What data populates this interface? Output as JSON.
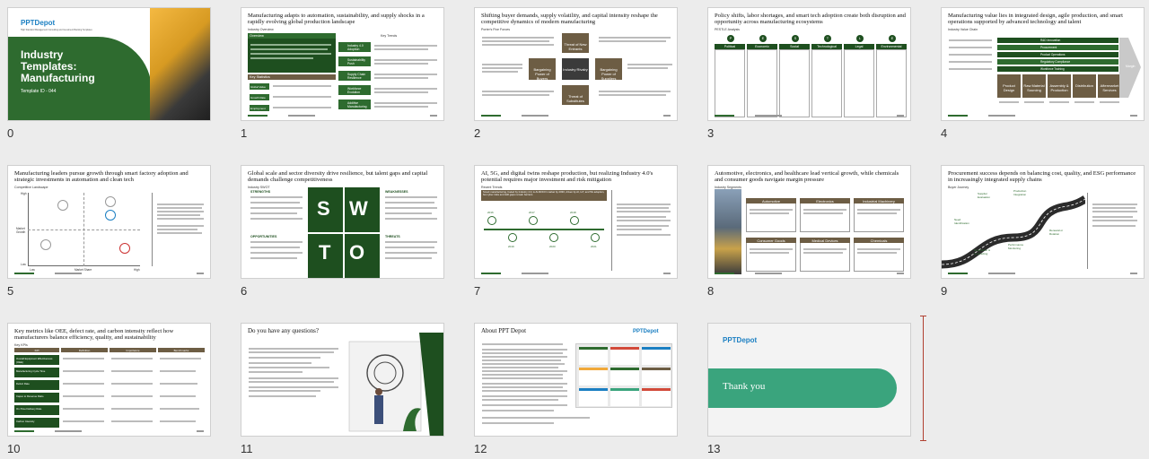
{
  "slides": [
    {
      "num": "0",
      "brand": "PPTDepot",
      "tagline": "High Standard Management Consulting and Investment Banking Templates",
      "title_line1": "Industry",
      "title_line2": "Templates:",
      "title_line3": "Manufacturing",
      "template_id": "Template ID - 044"
    },
    {
      "num": "1",
      "title": "Manufacturing adapts to automation, sustainability, and supply shocks in a rapidly evolving global production landscape",
      "sub": "Industry Overview",
      "box1": "Overview",
      "box2": "Key Statistics",
      "trends_header": "Key Trends",
      "trends": [
        "Industry 4.0 Adoption",
        "Sustainability Push",
        "Supply Chain Resilience",
        "Workforce Evolution",
        "Additive Manufacturing"
      ],
      "stats": [
        "Global Value",
        "Growth Rate",
        "Employment"
      ]
    },
    {
      "num": "2",
      "title": "Shifting buyer demands, supply volatility, and capital intensity reshape the competitive dynamics of modern manufacturing",
      "sub": "Porter's Five Forces",
      "forces": [
        "Threat of New Entrants",
        "Bargaining Power of Buyers",
        "Industry Rivalry",
        "Bargaining Power of Suppliers",
        "Threat of Substitutes"
      ]
    },
    {
      "num": "3",
      "title": "Policy shifts, labor shortages, and smart tech adoption create both disruption and opportunity across manufacturing ecosystems",
      "sub": "PESTLE Analysis",
      "pestle": [
        "Political",
        "Economic",
        "Social",
        "Technological",
        "Legal",
        "Environmental"
      ],
      "pestle_letters": [
        "P",
        "E",
        "S",
        "T",
        "L",
        "E"
      ]
    },
    {
      "num": "4",
      "title": "Manufacturing value lies in integrated design, agile production, and smart operations supported by advanced technology and talent",
      "sub": "Industry Value Chain",
      "support": [
        "R&D Innovation",
        "Procurement",
        "Product Operations",
        "Regulatory Compliance",
        "Workforce Training"
      ],
      "primary": [
        "Product Design",
        "Raw Material Sourcing",
        "Assembly & Production",
        "Distribution",
        "Aftermarket Services"
      ],
      "margin_label": "Margin"
    },
    {
      "num": "5",
      "title": "Manufacturing leaders pursue growth through smart factory adoption and strategic investments in automation and clean tech",
      "sub": "Competitive Landscape",
      "y_high": "High",
      "y_mid": "Market Growth",
      "y_low": "Low",
      "x_low": "Low",
      "x_mid": "Market Share",
      "x_high": "High"
    },
    {
      "num": "6",
      "title": "Global scale and sector diversity drive resilience, but talent gaps and capital demands challenge competitiveness",
      "sub": "Industry SWOT",
      "swot": [
        "S",
        "W",
        "T",
        "O"
      ],
      "labels": [
        "STRENGTHS",
        "WEAKNESSES",
        "OPPORTUNITIES",
        "THREATS"
      ]
    },
    {
      "num": "7",
      "title": "AI, 5G, and digital twins reshape production, but realizing Industry 4.0's potential requires major investment and risk mitigation",
      "sub": "Recent Trends",
      "banner": "Smart manufacturing, fueled by Industry 4.0, is AI-MOCO market by 2030, driven by AI, IoT, and 5G adoption, but cyber risks and skill gaps remain barriers",
      "years": [
        "2016",
        "2017",
        "2018",
        "2019",
        "2020",
        "2021"
      ]
    },
    {
      "num": "8",
      "title": "Automotive, electronics, and healthcare lead vertical growth, while chemicals and consumer goods navigate margin pressure",
      "sub": "Industry Segments",
      "segments": [
        "Automotive",
        "Electronics",
        "Industrial Machinery",
        "Consumer Goods",
        "Medical Devices",
        "Chemicals"
      ]
    },
    {
      "num": "9",
      "title": "Procurement success depends on balancing cost, quality, and ESG performance in increasingly integrated supply chains",
      "sub": "Buyer Journey",
      "steps": [
        "Need Identification",
        "Supplier Evaluation",
        "Production Integration",
        "Negotiation & Contracting",
        "Performance Monitoring",
        "Renewal or Rotation"
      ]
    },
    {
      "num": "10",
      "title": "Key metrics like OEE, defect rate, and carbon intensity reflect how manufacturers balance efficiency, quality, and sustainability",
      "sub": "Key KPIs",
      "headers": [
        "KPI",
        "Definition",
        "Importance",
        "Benchmarks"
      ],
      "kpis": [
        "Overall Equipment Effectiveness (OEE)",
        "Manufacturing Cycle Time",
        "Defect Rate",
        "Capex to Revenue Ratio",
        "On-Time Delivery Rate",
        "Carbon Intensity"
      ]
    },
    {
      "num": "11",
      "title": "Do you have any questions?"
    },
    {
      "num": "12",
      "title": "About PPT Depot",
      "brand": "PPTDepot"
    },
    {
      "num": "13",
      "brand": "PPTDepot",
      "thanks": "Thank you"
    }
  ],
  "colors": {
    "accent_green": "#2e6b2f",
    "dark_green": "#1e4f1f",
    "brown": "#6d5d44",
    "teal": "#3aa47d",
    "brand_blue": "#1b7fc2"
  }
}
